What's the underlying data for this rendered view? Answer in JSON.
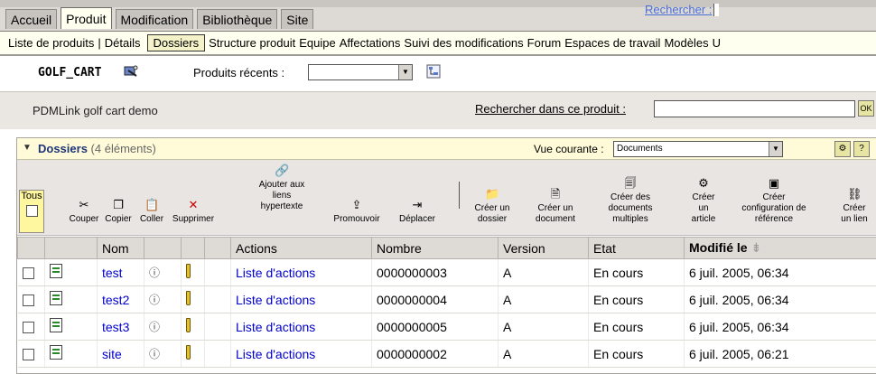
{
  "tabs": [
    {
      "label": "Accueil"
    },
    {
      "label": "Produit"
    },
    {
      "label": "Modification"
    },
    {
      "label": "Bibliothèque"
    },
    {
      "label": "Site"
    }
  ],
  "top_search_link": "Rechercher :",
  "subnav": {
    "items": [
      "Liste de produits",
      "|",
      "Détails",
      "Dossiers",
      "Structure produit",
      "Equipe",
      "Affectations",
      "Suivi des modifications",
      "Forum",
      "Espaces de travail",
      "Modèles",
      "U"
    ],
    "selected": "Dossiers"
  },
  "object": {
    "name": "GOLF_CART",
    "recent_label": "Produits récents :",
    "description": "PDMLink golf cart demo",
    "search_in_product": "Rechercher dans ce produit :",
    "ok_label": "OK"
  },
  "panel": {
    "title": "Dossiers",
    "count": "(4 éléments)",
    "view_label": "Vue courante :",
    "view_value": "Documents",
    "help_label": "?"
  },
  "toolbar": {
    "all_label": "Tous",
    "cut": "Couper",
    "copy": "Copier",
    "paste": "Coller",
    "delete": "Supprimer",
    "add_hyperlinks_1": "Ajouter aux",
    "add_hyperlinks_2": "liens",
    "add_hyperlinks_3": "hypertexte",
    "promote": "Promouvoir",
    "move": "Déplacer",
    "create_folder_1": "Créer un",
    "create_folder_2": "dossier",
    "create_document_1": "Créer un",
    "create_document_2": "document",
    "create_multi_1": "Créer des",
    "create_multi_2": "documents",
    "create_multi_3": "multiples",
    "create_article_1": "Créer",
    "create_article_2": "un",
    "create_article_3": "article",
    "create_config_1": "Créer",
    "create_config_2": "configuration de",
    "create_config_3": "référence",
    "create_link_1": "Créer",
    "create_link_2": "un lien"
  },
  "table": {
    "headers": {
      "name": "Nom",
      "actions": "Actions",
      "number": "Nombre",
      "version": "Version",
      "state": "Etat",
      "modified": "Modifié le"
    },
    "rows": [
      {
        "name": "test",
        "actions": "Liste d'actions",
        "number": "0000000003",
        "version": "A",
        "state": "En cours",
        "modified": "6 juil. 2005, 06:34"
      },
      {
        "name": "test2",
        "actions": "Liste d'actions",
        "number": "0000000004",
        "version": "A",
        "state": "En cours",
        "modified": "6 juil. 2005, 06:34"
      },
      {
        "name": "test3",
        "actions": "Liste d'actions",
        "number": "0000000005",
        "version": "A",
        "state": "En cours",
        "modified": "6 juil. 2005, 06:34"
      },
      {
        "name": "site",
        "actions": "Liste d'actions",
        "number": "0000000002",
        "version": "A",
        "state": "En cours",
        "modified": "6 juil. 2005, 06:21"
      }
    ]
  }
}
